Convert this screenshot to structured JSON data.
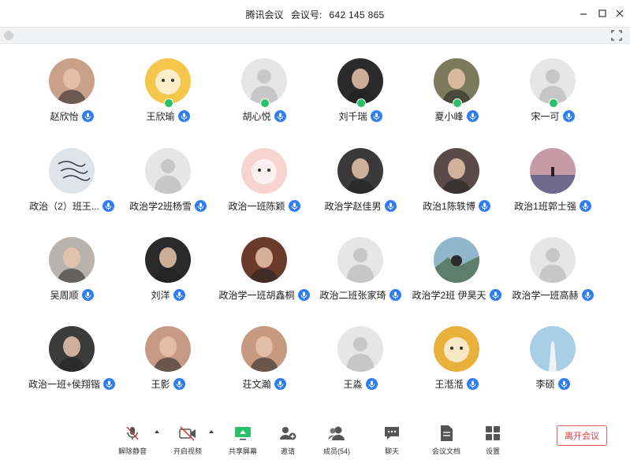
{
  "window": {
    "app_name": "腾讯会议",
    "meeting_id_label": "会议号:",
    "meeting_id": "642 145 865"
  },
  "participants": [
    {
      "name": "赵欣怡",
      "avatar": "photo",
      "color": "#c9a089"
    },
    {
      "name": "王欣瑜",
      "avatar": "cartoon-tiger",
      "color": "#f4c64a",
      "host_badge": true
    },
    {
      "name": "胡心悦",
      "avatar": "default",
      "color": "#e6e6e6",
      "host_badge": true
    },
    {
      "name": "刘千瑞",
      "avatar": "photo",
      "color": "#2b2b2b",
      "host_badge": true
    },
    {
      "name": "夏小峰",
      "avatar": "photo",
      "color": "#7b7a5c",
      "host_badge": true
    },
    {
      "name": "宋一可",
      "avatar": "default",
      "color": "#e6e6e6",
      "host_badge": true
    },
    {
      "name": "政治（2）班王...",
      "avatar": "calligraphy",
      "color": "#dfe3ea"
    },
    {
      "name": "政治学2班杨雪",
      "avatar": "default",
      "color": "#e6e6e6"
    },
    {
      "name": "政治一班陈颖",
      "avatar": "cartoon-pig",
      "color": "#f7d4cf"
    },
    {
      "name": "政治学赵佳男",
      "avatar": "photo",
      "color": "#3a3a3a"
    },
    {
      "name": "政治1陈轶博",
      "avatar": "photo",
      "color": "#5a4a4a"
    },
    {
      "name": "政治1班郭士强",
      "avatar": "sunset",
      "color": "#c79aa8"
    },
    {
      "name": "吴周顺",
      "avatar": "photo",
      "color": "#b9b3ad"
    },
    {
      "name": "刘洋",
      "avatar": "photo",
      "color": "#2a2a2a"
    },
    {
      "name": "政治学一班胡鑫桐",
      "avatar": "photo",
      "color": "#6a3a2a"
    },
    {
      "name": "政治二班张家琦",
      "avatar": "default",
      "color": "#e6e6e6"
    },
    {
      "name": "政治学2班 伊昊天",
      "avatar": "landscape",
      "color": "#8fb7c9"
    },
    {
      "name": "政治学一班高赫",
      "avatar": "default",
      "color": "#e6e6e6"
    },
    {
      "name": "政治一班+侯翔锴",
      "avatar": "photo",
      "color": "#3b3b3b"
    },
    {
      "name": "王影",
      "avatar": "photo",
      "color": "#c79a86"
    },
    {
      "name": "荘文瀚",
      "avatar": "photo",
      "color": "#c69a7e"
    },
    {
      "name": "王淼",
      "avatar": "default",
      "color": "#e6e6e6"
    },
    {
      "name": "王湉湉",
      "avatar": "cartoon-pikachu",
      "color": "#e9b13c"
    },
    {
      "name": "李硕",
      "avatar": "illustration",
      "color": "#a9cfe6"
    }
  ],
  "toolbar": {
    "unmute": "解除静音",
    "start_video": "开启视频",
    "share_screen": "共享屏幕",
    "invite": "邀请",
    "members": "成员(54)",
    "chat": "聊天",
    "docs": "会议文档",
    "settings": "设置",
    "leave": "离开会议"
  },
  "colors": {
    "mic_blue": "#2f7df6",
    "leave_red": "#e03c3c",
    "share_green": "#2bbf6a",
    "host_badge_green": "#2bbf6a"
  }
}
